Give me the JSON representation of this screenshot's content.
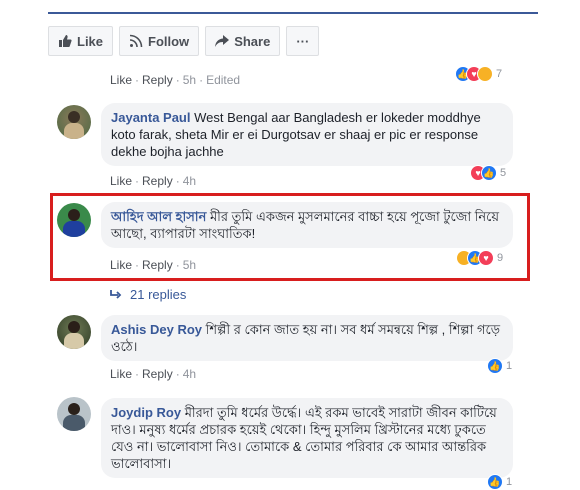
{
  "actions": {
    "like": "Like",
    "follow": "Follow",
    "share": "Share",
    "more": "···"
  },
  "top_meta": {
    "like": "Like",
    "reply": "Reply",
    "time": "5h",
    "edited": "Edited",
    "reaction_count": "7"
  },
  "comments": [
    {
      "author": "Jayanta Paul",
      "text": "West Bengal aar Bangladesh er lokeder moddhye koto farak, sheta Mir er ei Durgotsav er shaaj er pic er response dekhe bojha jachhe",
      "like": "Like",
      "reply": "Reply",
      "time": "4h",
      "reaction_count": "5"
    },
    {
      "author": "আহিদ আল হাসান",
      "text": "মীর তুমি একজন মুসলমানের বাচ্চা হয়ে পূজো টুজো নিয়ে আছো, ব্যাপারটা সাংঘাতিক!",
      "like": "Like",
      "reply": "Reply",
      "time": "5h",
      "reaction_count": "9"
    },
    {
      "author": "Ashis Dey Roy",
      "text": "শিল্পী র কোন জাত হয় না। সব ধর্ম সমন্বয়ে শিল্প , শিল্পা গড়ে ওঠে।",
      "like": "Like",
      "reply": "Reply",
      "time": "4h",
      "reaction_count": "1"
    },
    {
      "author": "Joydip Roy",
      "text": "মীরদা তুমি ধর্মের উর্দ্ধে। এই রকম ভাবেই সারাটা জীবন কাটিয়ে দাও। মনুষ্য ধর্মের প্রচারক হয়েই থেকো। হিন্দু মুসলিম খ্রিস্টানের মধ্যে ঢুকতে যেও না। ভালোবাসা নিও। তোমাকে & তোমার পরিবার কে আমার আন্তরিক ভালোবাসা।",
      "reaction_count": "1"
    }
  ],
  "replies_label": "21 replies",
  "colors": {
    "highlight": "#d81e1e",
    "link": "#385898",
    "bubble": "#f2f3f5"
  }
}
